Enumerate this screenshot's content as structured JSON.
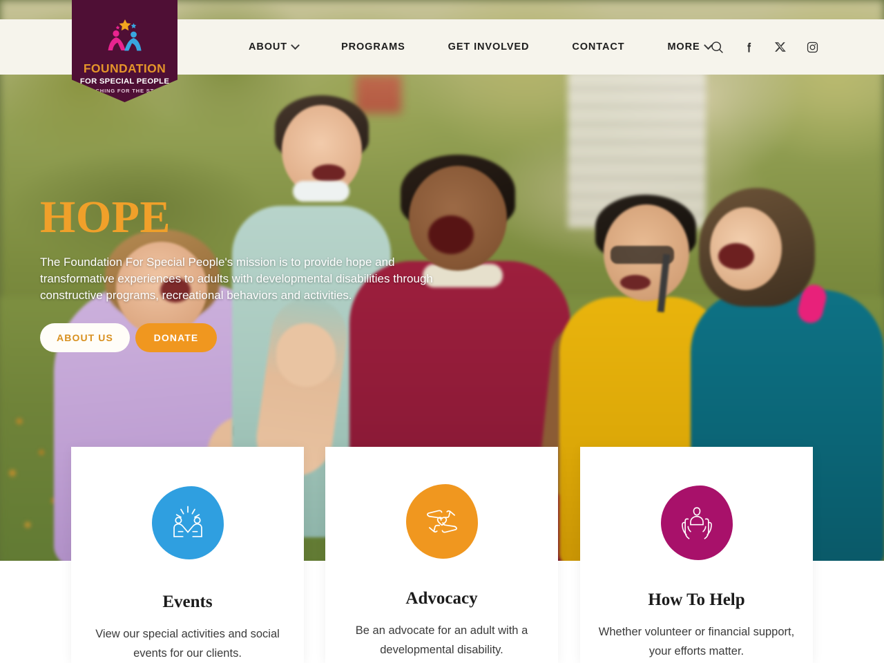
{
  "site": {
    "logo": {
      "word": "FOUNDATION",
      "subtitle": "FOR SPECIAL PEOPLE",
      "tagline": "REACHING FOR THE STARS",
      "banner_color": "#4f0f35",
      "word_color": "#e4952a"
    },
    "header_bg": "#f6f4ec"
  },
  "nav": {
    "items": [
      {
        "label": "ABOUT",
        "has_dropdown": true
      },
      {
        "label": "PROGRAMS",
        "has_dropdown": false
      },
      {
        "label": "GET INVOLVED",
        "has_dropdown": false
      },
      {
        "label": "CONTACT",
        "has_dropdown": false
      },
      {
        "label": "MORE",
        "has_dropdown": true
      }
    ],
    "actions": [
      {
        "icon": "search-icon",
        "name": "search"
      },
      {
        "icon": "facebook-icon",
        "name": "facebook"
      },
      {
        "icon": "x-twitter-icon",
        "name": "x-twitter"
      },
      {
        "icon": "instagram-icon",
        "name": "instagram"
      }
    ]
  },
  "hero": {
    "title": "HOPE",
    "title_color": "#f0a02a",
    "body": "The Foundation For Special People's mission is to provide hope and transformative experiences to adults with developmental disabilities through constructive programs, recreational behaviors and activities.",
    "buttons": {
      "primary": {
        "label": "ABOUT US",
        "bg": "#fffdf8",
        "color": "#d8901f"
      },
      "secondary": {
        "label": "DONATE",
        "bg": "#f0971f",
        "color": "#ffffff"
      }
    }
  },
  "cards": [
    {
      "title": "Events",
      "text": "View our special activities and social events for our clients.",
      "icon": "high-five-icon",
      "blob_color": "#2f9fe0"
    },
    {
      "title": "Advocacy",
      "text": "Be an advocate for an adult with a developmental disability.",
      "icon": "hands-heart-icon",
      "blob_color": "#f0971f"
    },
    {
      "title": "How To Help",
      "text": "Whether volunteer or financial support, your efforts matter.",
      "icon": "hands-person-icon",
      "blob_color": "#a8116a"
    }
  ]
}
